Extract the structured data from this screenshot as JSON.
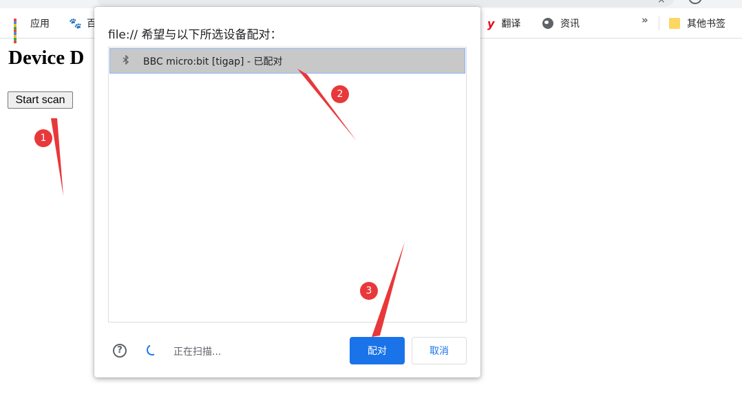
{
  "browser": {
    "bookmarks": [
      {
        "label": "应用",
        "icon": "apps-grid-icon"
      },
      {
        "label": "百",
        "icon": "baidu-paw-icon"
      },
      {
        "label": "翻译",
        "icon": "youdao-icon"
      },
      {
        "label": "资讯",
        "icon": "globe-icon"
      }
    ],
    "overflow_label": "»",
    "other_bookmarks_label": "其他书签",
    "omnibox_close": "×"
  },
  "page": {
    "title": "Device D",
    "start_scan_label": "Start scan"
  },
  "dialog": {
    "title": "file:// 希望与以下所选设备配对：",
    "devices": [
      {
        "name": "BBC micro:bit [tigap] - 已配对",
        "icon": "bluetooth-icon"
      }
    ],
    "help_glyph": "?",
    "status": "正在扫描...",
    "pair_label": "配对",
    "cancel_label": "取消"
  },
  "annotations": [
    {
      "number": "1"
    },
    {
      "number": "2"
    },
    {
      "number": "3"
    }
  ],
  "colors": {
    "accent": "#1a73e8",
    "annotation": "#e8383a",
    "selected_row": "#c8c8c8"
  }
}
